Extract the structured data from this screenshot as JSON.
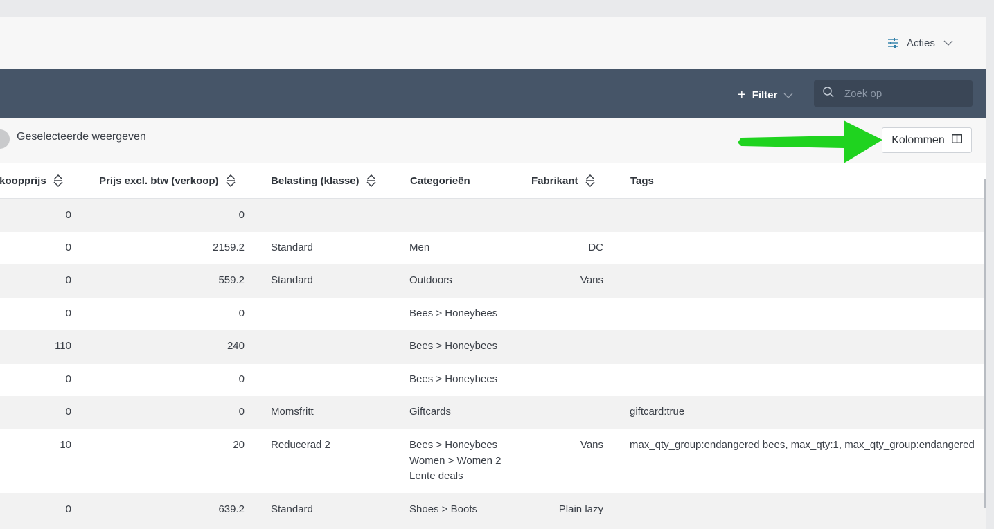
{
  "header": {
    "acties_label": "Acties"
  },
  "toolbar": {
    "filter_label": "Filter",
    "search_placeholder": "Zoek op"
  },
  "selection": {
    "toggle_label": "Geselecteerde weergeven",
    "kolommen_label": "Kolommen"
  },
  "table": {
    "columns": [
      {
        "label": "nkoopprijs",
        "sortable": true
      },
      {
        "label": "Prijs excl. btw (verkoop)",
        "sortable": true
      },
      {
        "label": "Belasting (klasse)",
        "sortable": true
      },
      {
        "label": "Categorieën",
        "sortable": false
      },
      {
        "label": "Fabrikant",
        "sortable": true
      },
      {
        "label": "Tags",
        "sortable": false
      }
    ],
    "rows": [
      {
        "inkoop": "0",
        "prijs": "0",
        "belasting": "",
        "categorieen": [],
        "fabrikant": "",
        "tags": ""
      },
      {
        "inkoop": "0",
        "prijs": "2159.2",
        "belasting": "Standard",
        "categorieen": [
          "Men"
        ],
        "fabrikant": "DC",
        "tags": ""
      },
      {
        "inkoop": "0",
        "prijs": "559.2",
        "belasting": "Standard",
        "categorieen": [
          "Outdoors"
        ],
        "fabrikant": "Vans",
        "tags": ""
      },
      {
        "inkoop": "0",
        "prijs": "0",
        "belasting": "",
        "categorieen": [
          "Bees > Honeybees"
        ],
        "fabrikant": "",
        "tags": ""
      },
      {
        "inkoop": "110",
        "prijs": "240",
        "belasting": "",
        "categorieen": [
          "Bees > Honeybees"
        ],
        "fabrikant": "",
        "tags": ""
      },
      {
        "inkoop": "0",
        "prijs": "0",
        "belasting": "",
        "categorieen": [
          "Bees > Honeybees"
        ],
        "fabrikant": "",
        "tags": ""
      },
      {
        "inkoop": "0",
        "prijs": "0",
        "belasting": "Momsfritt",
        "categorieen": [
          "Giftcards"
        ],
        "fabrikant": "",
        "tags": "giftcard:true"
      },
      {
        "inkoop": "10",
        "prijs": "20",
        "belasting": "Reducerad 2",
        "categorieen": [
          "Bees > Honeybees",
          "Women > Women 2",
          "Lente deals"
        ],
        "fabrikant": "Vans",
        "tags": "max_qty_group:endangered bees, max_qty:1, max_qty_group:endangered"
      },
      {
        "inkoop": "0",
        "prijs": "639.2",
        "belasting": "Standard",
        "categorieen": [
          "Shoes > Boots"
        ],
        "fabrikant": "Plain lazy",
        "tags": ""
      }
    ]
  },
  "colors": {
    "dark_bar": "#465568",
    "search_bg": "#3a4656",
    "row_stripe": "#f2f2f2",
    "annotation_arrow": "#1fd31f"
  }
}
